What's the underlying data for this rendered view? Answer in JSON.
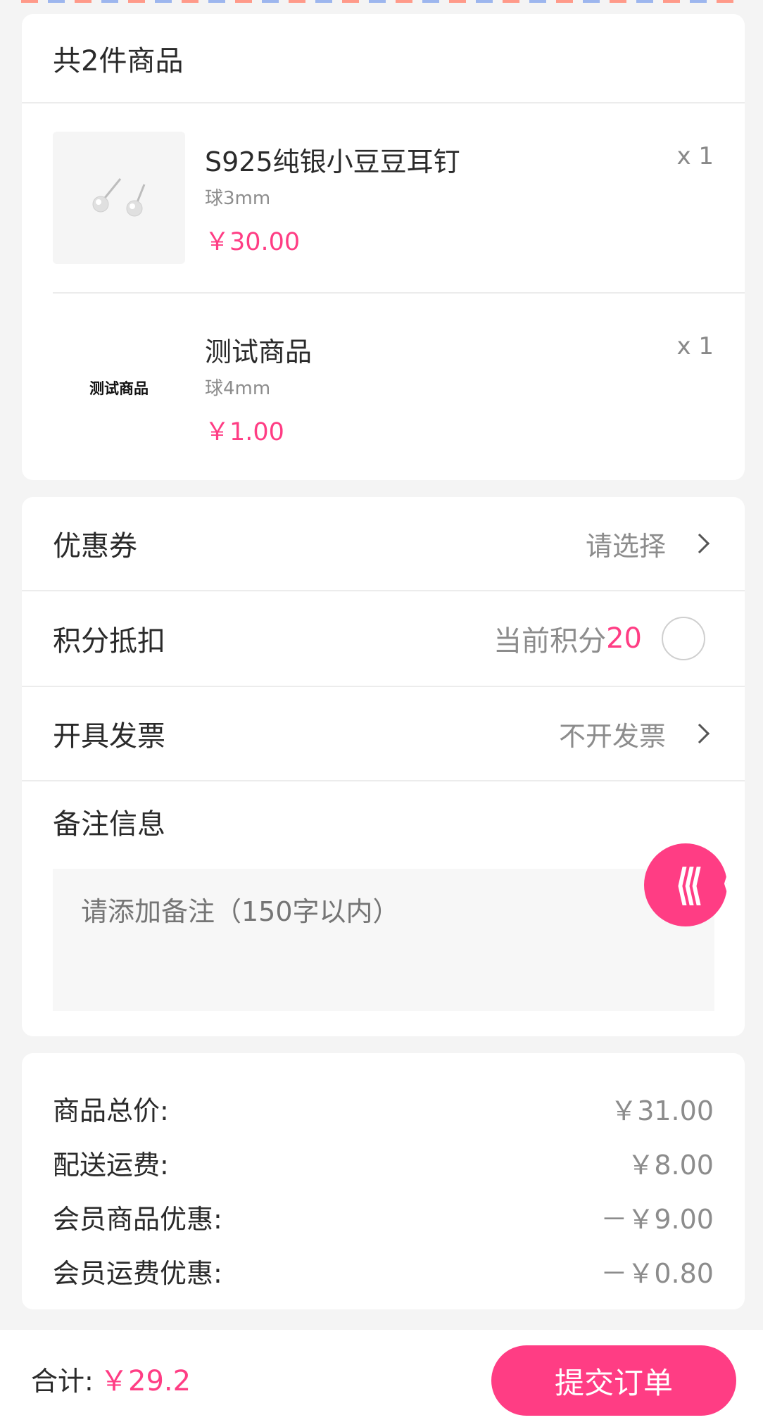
{
  "goods": {
    "header": "共2件商品",
    "items": [
      {
        "name": "S925纯银小豆豆耳钉",
        "spec": "球3mm",
        "price": "￥30.00",
        "qty": "x 1",
        "thumb_text": ""
      },
      {
        "name": "测试商品",
        "spec": "球4mm",
        "price": "￥1.00",
        "qty": "x 1",
        "thumb_text": "测试商品"
      }
    ]
  },
  "options": {
    "coupon_label": "优惠券",
    "coupon_value": "请选择",
    "points_label": "积分抵扣",
    "points_current_label": "当前积分",
    "points_current_value": "20",
    "invoice_label": "开具发票",
    "invoice_value": "不开发票",
    "remark_label": "备注信息",
    "remark_placeholder": "请添加备注（150字以内）"
  },
  "summary": {
    "rows": [
      {
        "label": "商品总价:",
        "value": "￥31.00"
      },
      {
        "label": "配送运费:",
        "value": "￥8.00"
      },
      {
        "label": "会员商品优惠:",
        "value": "－￥9.00"
      },
      {
        "label": "会员运费优惠:",
        "value": "－￥0.80"
      }
    ]
  },
  "footer": {
    "total_label": "合计:",
    "total_value": "￥29.2",
    "submit_label": "提交订单"
  },
  "colors": {
    "accent": "#ff3d84",
    "background": "#f4f4f4",
    "muted_text": "#8c8c8c"
  },
  "icons": [
    "chevron-right-icon",
    "radio-unchecked-icon",
    "earring-product-image",
    "back-arrows-icon"
  ]
}
